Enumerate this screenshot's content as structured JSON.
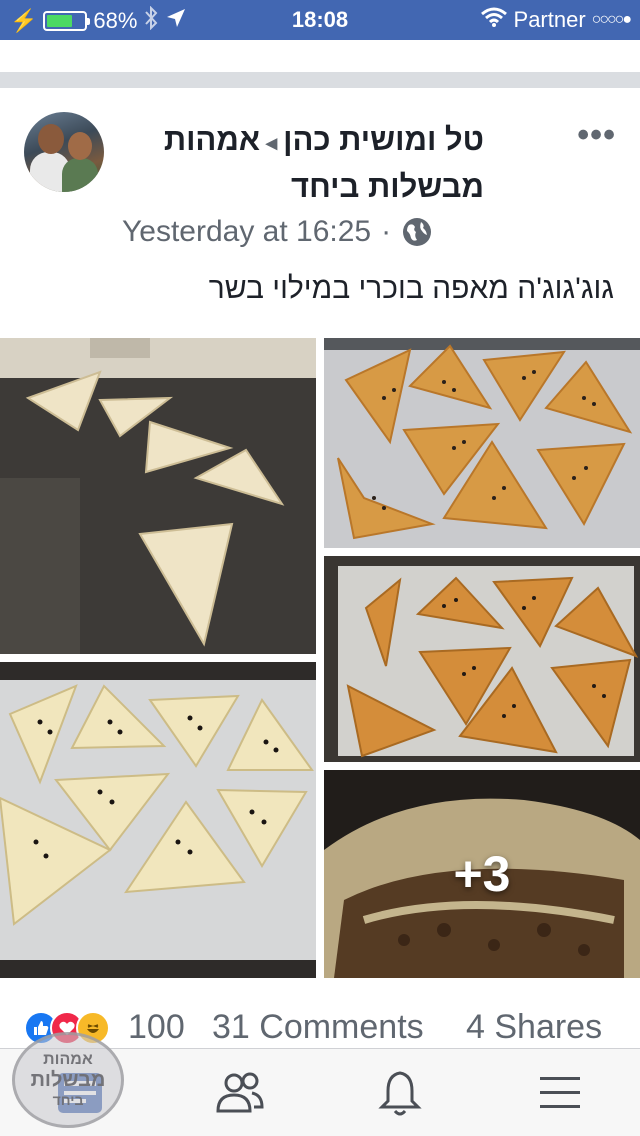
{
  "status_bar": {
    "battery_percent": "68%",
    "battery_level": 0.68,
    "time": "18:08",
    "carrier": "Partner",
    "signal_dots": "○○○○●"
  },
  "post": {
    "author": "טל ומושית כהן",
    "group": "אמהות מבשלות ביחד",
    "timestamp": "Yesterday at 16:25",
    "separator": "·",
    "privacy_icon": "globe-icon",
    "text": "גוג'גוג'ה מאפה בוכרי במילוי בשר",
    "more_photos": "+3"
  },
  "engagement": {
    "reaction_count": "100",
    "comments": "31 Comments",
    "shares": "4 Shares",
    "reaction_icons": [
      "like-icon",
      "love-icon",
      "haha-icon"
    ]
  },
  "watermark": {
    "line1": "אמהות",
    "line2": "מבשלות",
    "line3": "ביחד"
  },
  "tabbar": {
    "items": [
      "news-feed-icon",
      "friends-icon",
      "notifications-icon",
      "menu-icon"
    ]
  },
  "colors": {
    "brand": "#4267b2",
    "text_secondary": "#606770",
    "separator": "#dadde1"
  }
}
